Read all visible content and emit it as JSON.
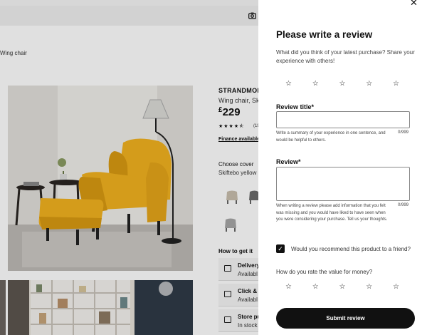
{
  "product_page": {
    "breadcrumb": "Wing chair",
    "name": "STRANDMON",
    "description": "Wing chair, Skif",
    "price_currency": "£",
    "price_amount": "229",
    "rating_stars": "★★★★⯪",
    "rating_count": "(19",
    "finance_link": "Finance available f",
    "cover_label": "Choose cover",
    "cover_value": "Skiftebo yellow",
    "how_to_get": "How to get it",
    "delivery_options": [
      {
        "title": "Delivery",
        "subtitle": "Availabl"
      },
      {
        "title": "Click & C",
        "subtitle": "Availabl"
      },
      {
        "title": "Store pu",
        "subtitle": "In stock a"
      }
    ],
    "colors": {
      "chair": "#f2b21f",
      "chair_dark": "#d99a12",
      "swatch_beige": "#c9bfae",
      "swatch_dark": "#6b6b6b",
      "swatch_grey": "#a7a7a7"
    }
  },
  "review_panel": {
    "title": "Please write a review",
    "intro": "What did you think of your latest purchase? Share your experience with others!",
    "star_symbol": "☆",
    "rating_stars_count": 5,
    "review_title_label": "Review title*",
    "review_title_value": "",
    "review_title_help": "Write a summary of your experience in one sentence, and would be helpful to others.",
    "review_title_counter": "0/999",
    "review_label": "Review*",
    "review_value": "",
    "review_help": "When writing a review please add information that you felt was missing and you would have liked to have seen when you were considering your purchase. Tell us your thoughts.",
    "review_counter": "0/999",
    "recommend_label": "Would you recommend this product to a friend?",
    "recommend_checked": true,
    "value_question": "How do you rate the value for money?",
    "submit_label": "Submit review",
    "close_icon": "close-icon"
  }
}
